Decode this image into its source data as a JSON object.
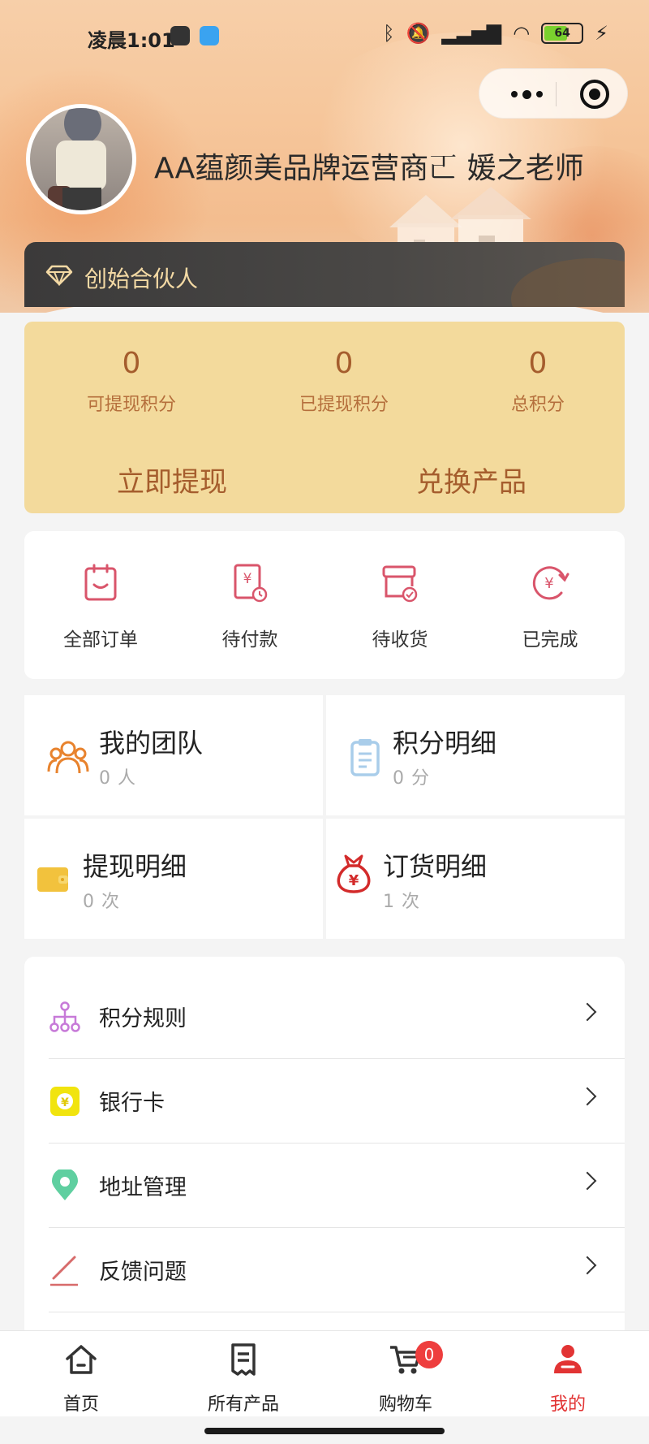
{
  "status_bar": {
    "time": "凌晨1:01",
    "battery": "64"
  },
  "profile": {
    "username": "AA蕴颜美品牌运营商𠀀 媛之老师",
    "level": "创始合伙人"
  },
  "points": {
    "withdrawable": {
      "value": "0",
      "label": "可提现积分"
    },
    "withdrawn": {
      "value": "0",
      "label": "已提现积分"
    },
    "total": {
      "value": "0",
      "label": "总积分"
    },
    "withdraw_button": "立即提现",
    "exchange_button": "兑换产品"
  },
  "orders": [
    {
      "label": "全部订单",
      "icon": "order-list-icon"
    },
    {
      "label": "待付款",
      "icon": "pending-payment-icon"
    },
    {
      "label": "待收货",
      "icon": "pending-receipt-icon"
    },
    {
      "label": "已完成",
      "icon": "completed-icon"
    }
  ],
  "stats": {
    "team": {
      "title": "我的团队",
      "sub": "0 人",
      "icon": "team-icon"
    },
    "points_detail": {
      "title": "积分明细",
      "sub": "0 分",
      "icon": "clipboard-icon"
    },
    "withdraw_detail": {
      "title": "提现明细",
      "sub": "0 次",
      "icon": "wallet-icon"
    },
    "order_detail": {
      "title": "订货明细",
      "sub": "1 次",
      "icon": "money-bag-icon"
    }
  },
  "menu": [
    {
      "label": "积分规则",
      "icon": "rules-tree-icon"
    },
    {
      "label": "银行卡",
      "icon": "bank-card-icon"
    },
    {
      "label": "地址管理",
      "icon": "location-pin-icon"
    },
    {
      "label": "反馈问题",
      "icon": "pen-icon"
    }
  ],
  "tabbar": {
    "home": "首页",
    "products": "所有产品",
    "cart": "购物车",
    "cart_badge": "0",
    "mine": "我的"
  },
  "colors": {
    "accent_red": "#e23434",
    "points_card_bg": "#f3da9c",
    "points_text": "#a55d2d",
    "founder_text": "#f3d9a4"
  }
}
